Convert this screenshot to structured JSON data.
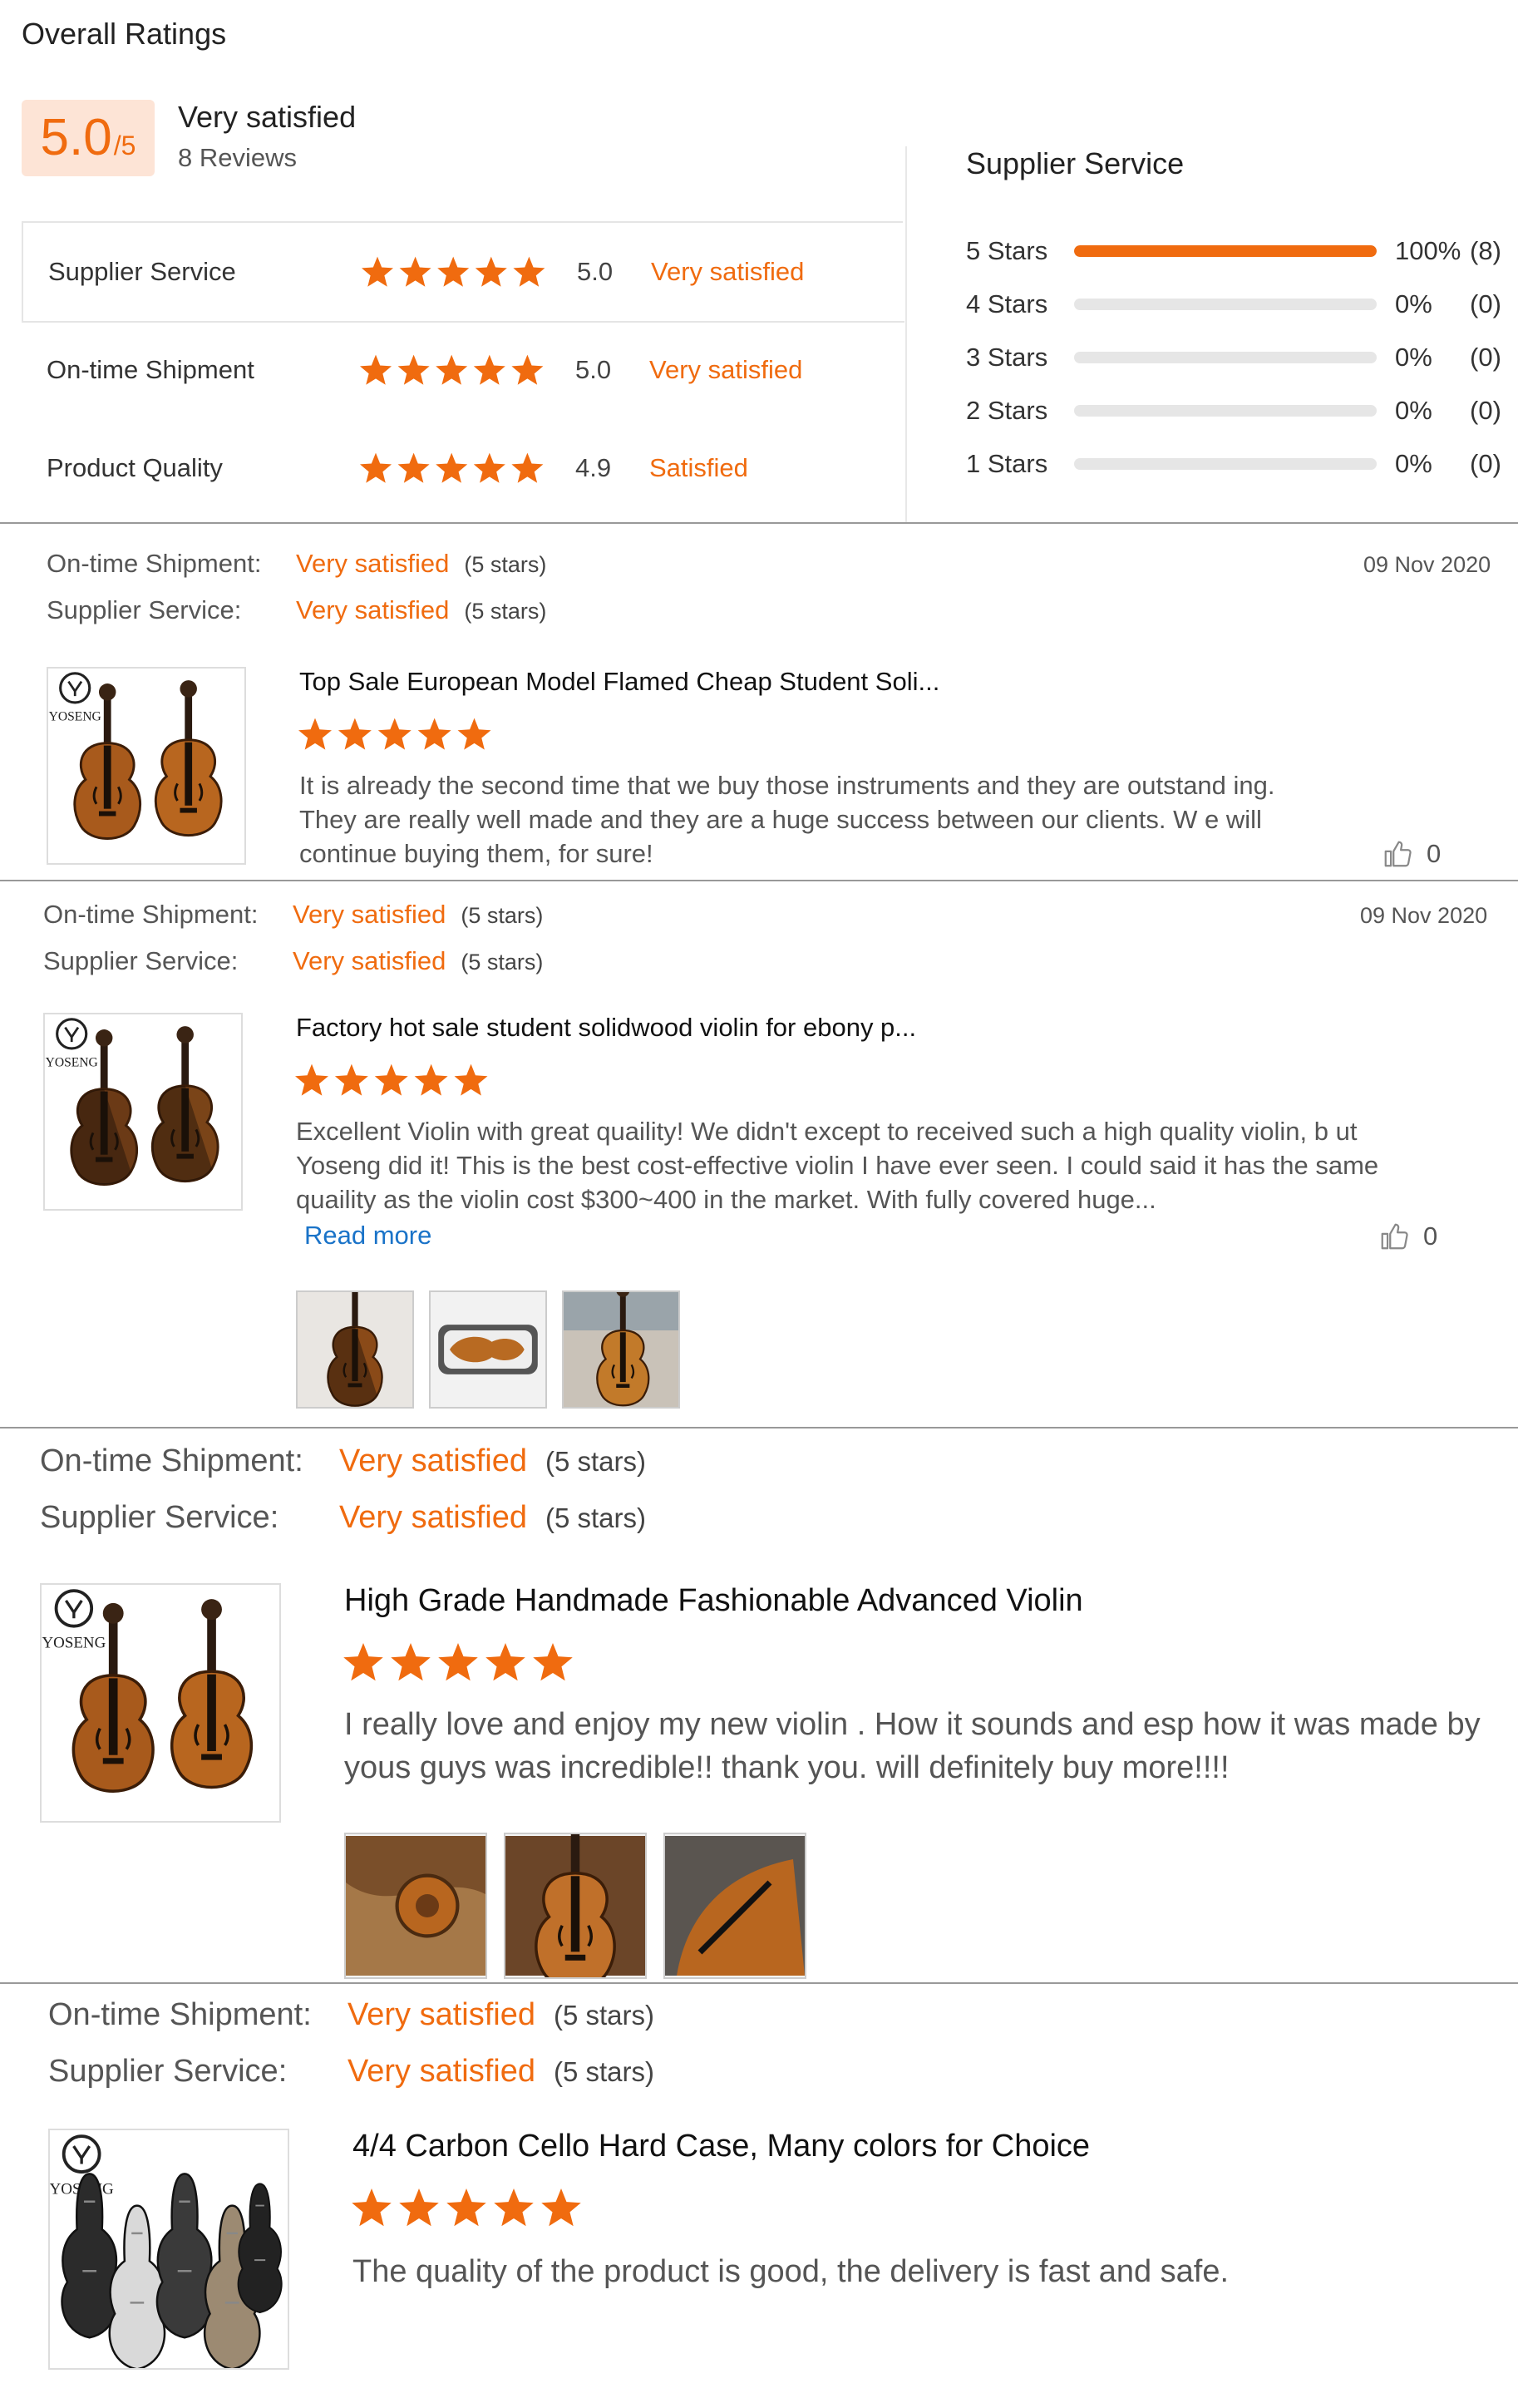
{
  "summary": {
    "title": "Overall Ratings",
    "score": "5.0",
    "score_den": "/5",
    "satisfaction": "Very satisfied",
    "reviews": "8 Reviews",
    "rows": [
      {
        "label": "Supplier Service",
        "value": "5.0",
        "desc": "Very satisfied",
        "rating": 5
      },
      {
        "label": "On-time Shipment",
        "value": "5.0",
        "desc": "Very satisfied",
        "rating": 5
      },
      {
        "label": "Product Quality",
        "value": "4.9",
        "desc": "Satisfied",
        "rating": 4.9
      }
    ]
  },
  "distribution": {
    "title": "Supplier Service",
    "rows": [
      {
        "label": "5 Stars",
        "pct": "100%",
        "count": "(8)",
        "fraction": 1.0
      },
      {
        "label": "4 Stars",
        "pct": "0%",
        "count": "(0)",
        "fraction": 0
      },
      {
        "label": "3 Stars",
        "pct": "0%",
        "count": "(0)",
        "fraction": 0
      },
      {
        "label": "2 Stars",
        "pct": "0%",
        "count": "(0)",
        "fraction": 0
      },
      {
        "label": "1 Stars",
        "pct": "0%",
        "count": "(0)",
        "fraction": 0
      }
    ]
  },
  "reviews": [
    {
      "shipment_label": "On-time Shipment:",
      "shipment_value": "Very satisfied",
      "shipment_stars": "(5 stars)",
      "service_label": "Supplier Service:",
      "service_value": "Very satisfied",
      "service_stars": "(5 stars)",
      "date": "09 Nov 2020",
      "product": "Top Sale European Model Flamed Cheap Student Soli...",
      "rating": 5,
      "text": "It is already the second time that we buy those instruments and they are outstand ing. They are really well made and they are a huge success between our clients. W e will continue buying them, for sure!",
      "likes": "0",
      "brand": "YOSENG"
    },
    {
      "shipment_label": "On-time Shipment:",
      "shipment_value": "Very satisfied",
      "shipment_stars": "(5 stars)",
      "service_label": "Supplier Service:",
      "service_value": "Very satisfied",
      "service_stars": "(5 stars)",
      "date": "09 Nov 2020",
      "product": "Factory hot sale student solidwood violin for ebony p...",
      "rating": 5,
      "text": "Excellent Violin with great quaility! We didn't except to received such a high quality violin, b ut Yoseng did it! This is the best cost-effective violin I have ever seen. I could said it has the same quaility as the violin cost $300~400 in the market. With fully covered huge...",
      "read_more": "Read more",
      "likes": "0",
      "brand": "YOSENG"
    },
    {
      "shipment_label": "On-time Shipment:",
      "shipment_value": "Very satisfied",
      "shipment_stars": "(5 stars)",
      "service_label": "Supplier Service:",
      "service_value": "Very satisfied",
      "service_stars": "(5 stars)",
      "product": "High Grade Handmade Fashionable Advanced Violin",
      "rating": 5,
      "text": "I really love and enjoy my new violin . How it sounds and esp how it was made by yous guys was incredible!! thank you. will definitely buy more!!!!",
      "brand": "YOSENG"
    },
    {
      "shipment_label": "On-time Shipment:",
      "shipment_value": "Very satisfied",
      "shipment_stars": "(5 stars)",
      "service_label": "Supplier Service:",
      "service_value": "Very satisfied",
      "service_stars": "(5 stars)",
      "product": "4/4 Carbon Cello Hard Case, Many colors for Choice",
      "rating": 5,
      "text": "The quality of the product is good, the delivery is fast and safe.",
      "brand": "YOSENG"
    }
  ],
  "colors": {
    "accent": "#f06b0f",
    "link": "#1a73c8"
  }
}
